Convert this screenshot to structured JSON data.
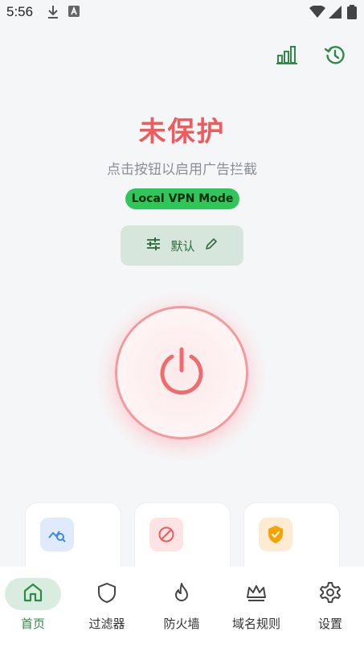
{
  "status_bar": {
    "time": "5:56"
  },
  "header": {
    "stats_icon": "bar-chart-icon",
    "history_icon": "history-icon"
  },
  "main": {
    "title": "未保护",
    "subtitle": "点击按钮以启用广告拦截",
    "mode_badge": "Local VPN Mode",
    "profile_label": "默认",
    "power_icon": "power-icon"
  },
  "cards": [
    {
      "icon": "query-stats-icon",
      "color": "#3f8ae0"
    },
    {
      "icon": "block-icon",
      "color": "#ef5b5b"
    },
    {
      "icon": "shield-check-icon",
      "color": "#f5a300"
    }
  ],
  "nav": {
    "items": [
      {
        "label": "首页",
        "icon": "home-icon",
        "active": true
      },
      {
        "label": "过滤器",
        "icon": "shield-icon",
        "active": false
      },
      {
        "label": "防火墙",
        "icon": "flame-icon",
        "active": false
      },
      {
        "label": "域名规则",
        "icon": "crown-icon",
        "active": false
      },
      {
        "label": "设置",
        "icon": "gear-icon",
        "active": false
      }
    ]
  },
  "colors": {
    "accent": "#2e8b46",
    "danger": "#ef5b5b",
    "badge": "#2fc75a"
  }
}
